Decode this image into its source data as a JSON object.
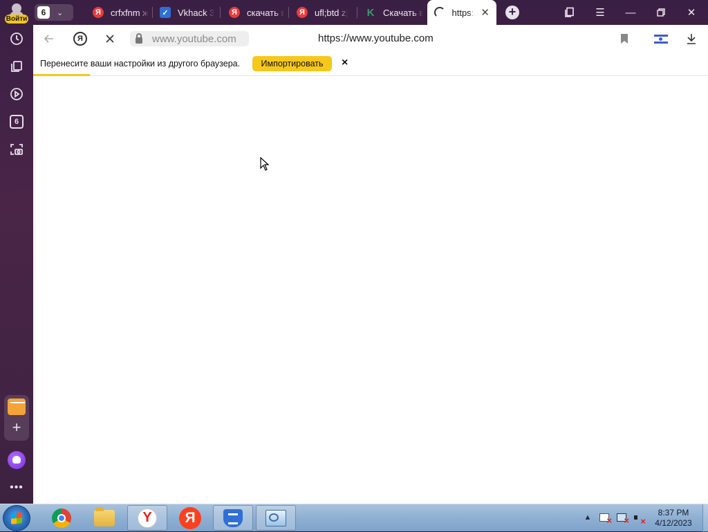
{
  "sidebar": {
    "login_label": "Войти",
    "items": [
      {
        "name": "history-icon"
      },
      {
        "name": "collections-icon"
      },
      {
        "name": "video-icon"
      },
      {
        "name": "tab-counter",
        "badge": "6"
      },
      {
        "name": "screenshot-icon"
      }
    ],
    "bottom": [
      "mail-icon",
      "add-panel-icon",
      "alice-icon",
      "more-icon"
    ]
  },
  "tabstrip": {
    "tab_count": "6",
    "tabs": [
      {
        "label": "crfxfnm ж",
        "icon": "yandex-icon"
      },
      {
        "label": "Vkhack 3",
        "icon": "vk-icon"
      },
      {
        "label": "скачать в",
        "icon": "yandex-icon"
      },
      {
        "label": "ufl;btd zj",
        "icon": "yandex-icon"
      },
      {
        "label": "Скачать в",
        "icon": "k-icon"
      }
    ],
    "active_tab": {
      "label": "https:/",
      "state": "loading"
    }
  },
  "address_bar": {
    "domain": "www.youtube.com",
    "full_url": "https://www.youtube.com"
  },
  "infobar": {
    "message": "Перенесите ваши настройки из другого браузера.",
    "import_label": "Импортировать",
    "close_symbol": "×"
  },
  "taskbar": {
    "apps": [
      "windows-start",
      "chrome",
      "file-explorer",
      "yandex-browser",
      "yandex",
      "shield-app",
      "remote-desktop"
    ],
    "clock": {
      "time": "8:37 PM",
      "date": "4/12/2023"
    }
  },
  "colors": {
    "accent": "#f7c81c",
    "frame": "#3a1f44",
    "yandex_red": "#fc3f1d"
  }
}
